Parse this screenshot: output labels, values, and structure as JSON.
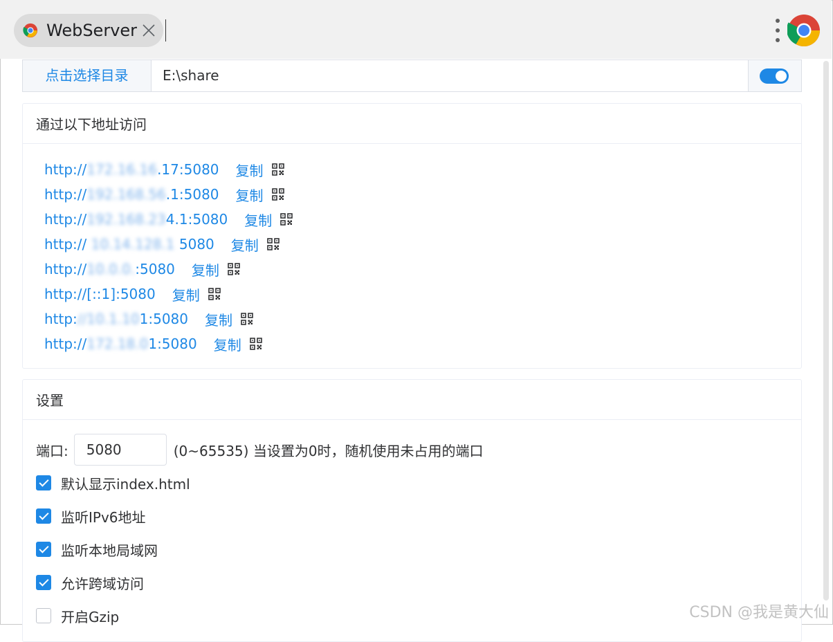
{
  "tab": {
    "title": "WebServer",
    "icon": "chrome-icon"
  },
  "directory": {
    "button_label": "点击选择目录",
    "path": "E:\\share",
    "server_enabled": true
  },
  "access": {
    "title": "通过以下地址访问",
    "copy_label": "复制",
    "urls": [
      {
        "prefix": "http://",
        "masked": "172.16.16",
        "suffix": ".17:5080"
      },
      {
        "prefix": "http://",
        "masked": "192.168.56",
        "suffix": ".1:5080"
      },
      {
        "prefix": "http://",
        "masked": "192.168.23",
        "suffix": "4.1:5080"
      },
      {
        "prefix": "http:// ",
        "masked": "10.14.128.1",
        "suffix": " 5080"
      },
      {
        "prefix": "http://",
        "masked": "10.0.0.",
        "suffix": ":5080"
      },
      {
        "prefix": "http://[::1]:5080",
        "masked": "",
        "suffix": ""
      },
      {
        "prefix": "http:",
        "masked": "//10.1.10",
        "suffix": "1:5080"
      },
      {
        "prefix": "http://",
        "masked": "172.18.0",
        "suffix": "1:5080"
      }
    ]
  },
  "settings": {
    "title": "设置",
    "port_label": "端口:",
    "port_value": "5080",
    "port_hint": "(0~65535) 当设置为0时，随机使用未占用的端口",
    "options": [
      {
        "label": "默认显示index.html",
        "checked": true
      },
      {
        "label": "监听IPv6地址",
        "checked": true
      },
      {
        "label": "监听本地局域网",
        "checked": true
      },
      {
        "label": "允许跨域访问",
        "checked": true
      },
      {
        "label": "开启Gzip",
        "checked": false
      }
    ]
  },
  "watermark": "CSDN @我是黄大仙",
  "colors": {
    "accent": "#1e88e5",
    "titlebar": "#f1f1f1",
    "tab": "#dcdcdc"
  }
}
